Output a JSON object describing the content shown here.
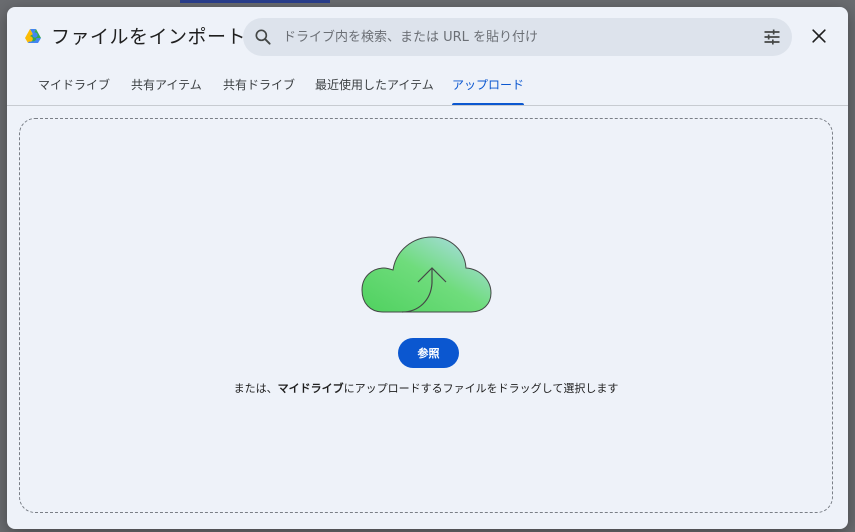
{
  "dialog": {
    "title": "ファイルをインポート",
    "search": {
      "placeholder": "ドライブ内を検索、または URL を貼り付け",
      "value": ""
    },
    "tabs": [
      {
        "label": "マイドライブ",
        "active": false
      },
      {
        "label": "共有アイテム",
        "active": false
      },
      {
        "label": "共有ドライブ",
        "active": false
      },
      {
        "label": "最近使用したアイテム",
        "active": false
      },
      {
        "label": "アップロード",
        "active": true
      }
    ],
    "upload": {
      "browse_label": "参照",
      "hint_prefix": "または、",
      "hint_bold": "マイドライブ",
      "hint_suffix": "にアップロードするファイルをドラッグして選択します"
    }
  },
  "icons": {
    "logo": "google-drive-logo",
    "search": "search-icon",
    "tune": "tune-icon",
    "close": "close-icon",
    "upload": "cloud-upload-icon"
  },
  "colors": {
    "accent": "#0b57d0",
    "dialog_bg": "#eef2f9",
    "search_bg": "#dde3ec"
  }
}
